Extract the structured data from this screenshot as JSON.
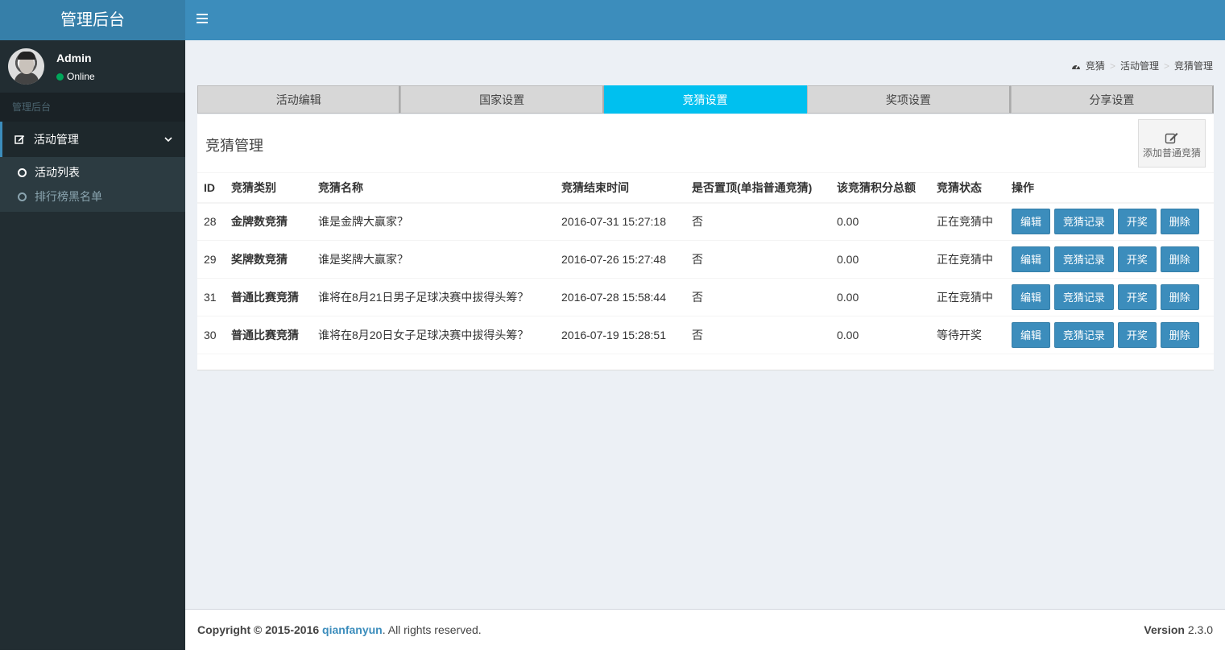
{
  "header": {
    "logo": "管理后台"
  },
  "user": {
    "name": "Admin",
    "status": "Online"
  },
  "sidebar": {
    "header": "管理后台",
    "menu": {
      "label": "活动管理"
    },
    "items": [
      {
        "label": "活动列表"
      },
      {
        "label": "排行榜黑名单"
      }
    ]
  },
  "breadcrumb": {
    "items": [
      "竞猜",
      "活动管理",
      "竞猜管理"
    ]
  },
  "tabs": [
    {
      "label": "活动编辑"
    },
    {
      "label": "国家设置"
    },
    {
      "label": "竞猜设置"
    },
    {
      "label": "奖项设置"
    },
    {
      "label": "分享设置"
    }
  ],
  "box": {
    "title": "竞猜管理",
    "add_button": "添加普通竞猜"
  },
  "table": {
    "headers": [
      "ID",
      "竞猜类别",
      "竞猜名称",
      "竞猜结束时间",
      "是否置顶(单指普通竞猜)",
      "该竞猜积分总额",
      "竞猜状态",
      "操作"
    ],
    "rows": [
      {
        "id": "28",
        "category": "金牌数竞猜",
        "name": "谁是金牌大赢家？",
        "end_time": "2016-07-31 15:27:18",
        "top": "否",
        "total": "0.00",
        "status": "正在竞猜中"
      },
      {
        "id": "29",
        "category": "奖牌数竞猜",
        "name": "谁是奖牌大赢家？",
        "end_time": "2016-07-26 15:27:48",
        "top": "否",
        "total": "0.00",
        "status": "正在竞猜中"
      },
      {
        "id": "31",
        "category": "普通比赛竞猜",
        "name": "谁将在8月21日男子足球决赛中拔得头筹？",
        "end_time": "2016-07-28 15:58:44",
        "top": "否",
        "total": "0.00",
        "status": "正在竞猜中"
      },
      {
        "id": "30",
        "category": "普通比赛竞猜",
        "name": "谁将在8月20日女子足球决赛中拔得头筹？",
        "end_time": "2016-07-19 15:28:51",
        "top": "否",
        "total": "0.00",
        "status": "等待开奖"
      }
    ],
    "actions": {
      "edit": "编辑",
      "records": "竞猜记录",
      "draw": "开奖",
      "delete": "删除"
    }
  },
  "footer": {
    "copyright": "Copyright © 2015-2016",
    "company": "qianfanyun",
    "suffix": ". All rights reserved.",
    "version_label": "Version",
    "version": "2.3.0"
  }
}
